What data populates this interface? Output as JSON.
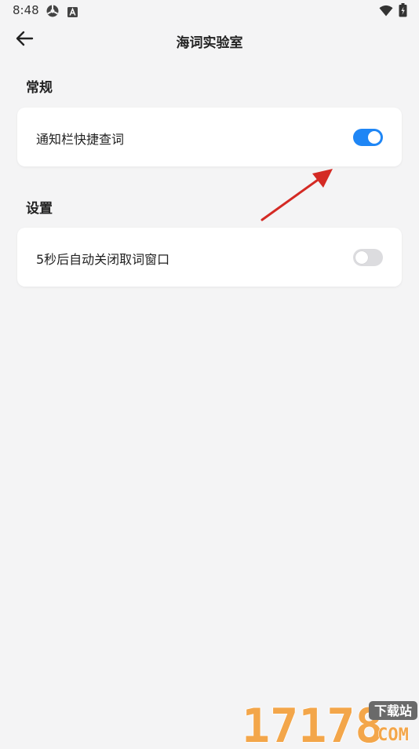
{
  "status_bar": {
    "time": "8:48",
    "icons": [
      "settings-gear-icon",
      "accessibility-a-icon",
      "wifi-icon",
      "battery-icon"
    ]
  },
  "nav": {
    "title": "海词实验室",
    "back_icon": "arrow-left-icon"
  },
  "sections": [
    {
      "header": "常规",
      "items": [
        {
          "label": "通知栏快捷查词",
          "toggle_on": true
        }
      ]
    },
    {
      "header": "设置",
      "items": [
        {
          "label": "5秒后自动关闭取词窗口",
          "toggle_on": false
        }
      ]
    }
  ],
  "annotation": {
    "type": "red-arrow",
    "color": "#d42a24"
  },
  "watermark": {
    "digits": "17178",
    "label_top": "下载站",
    "label_bottom": "COM",
    "color": "#f3a64a"
  },
  "colors": {
    "background": "#f4f4f5",
    "card": "#ffffff",
    "toggle_on": "#1f86f5",
    "toggle_off": "#dcdcdf"
  }
}
